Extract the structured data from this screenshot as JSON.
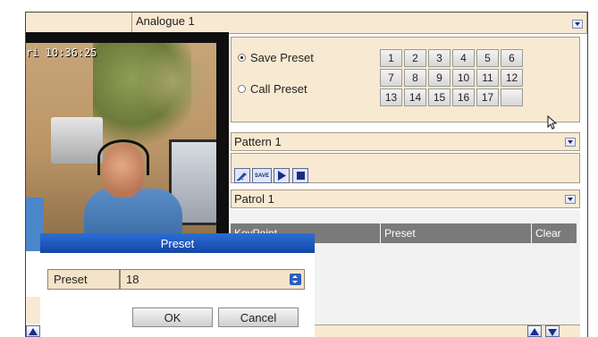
{
  "channel": {
    "selected": "Analogue 1"
  },
  "video": {
    "osd_text": "ri 10:36:25"
  },
  "preset_panel": {
    "save_label": "Save Preset",
    "call_label": "Call Preset",
    "selected_mode": "save",
    "numbers": [
      "1",
      "2",
      "3",
      "4",
      "5",
      "6",
      "7",
      "8",
      "9",
      "10",
      "11",
      "12",
      "13",
      "14",
      "15",
      "16",
      "17",
      ""
    ]
  },
  "pattern": {
    "selected": "Pattern 1",
    "save_label": "SAVE"
  },
  "patrol": {
    "selected": "Patrol 1",
    "columns": [
      "KeyPoint",
      "Preset",
      "Clear"
    ]
  },
  "dialog": {
    "title": "Preset",
    "field_label": "Preset",
    "field_value": "18",
    "ok_label": "OK",
    "cancel_label": "Cancel"
  },
  "colors": {
    "panel_beige": "#f8e9d2",
    "dialog_title_blue": "#1f58c0",
    "table_header_gray": "#7a7a7a"
  }
}
